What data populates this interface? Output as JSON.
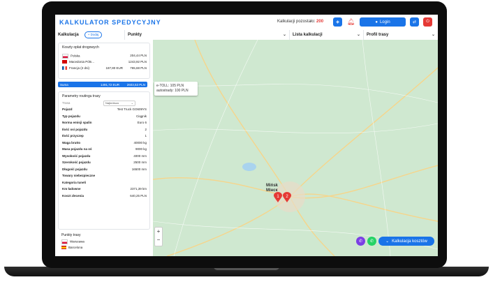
{
  "app": {
    "title": "KALKULATOR SPEDYCYJNY",
    "calc_left_label": "Kalkulacji pozostało:",
    "calc_left_value": "200",
    "login_label": "Login"
  },
  "nav": {
    "kalkulacja": "Kalkulacja",
    "dodaj": "Dodaj",
    "punkty": "Punkty",
    "lista_kalkulacji": "Lista kalkulacji",
    "profil_trasy": "Profil trasy"
  },
  "tolls": {
    "title": "Koszty opłat drogowych",
    "rows": [
      {
        "country": "Polska",
        "value": "204,44 PLN"
      },
      {
        "country": "Macedonia Półn...",
        "value": "1243,92 PLN"
      },
      {
        "country": "Francja (2 dni)",
        "value": "187,80 EUR",
        "value2": "765,68 PLN"
      }
    ],
    "sum_label": "Suma",
    "sum_eur": "1491,72 EUR",
    "sum_pln": "2603,53 PLN"
  },
  "routing": {
    "title": "Parametry routingu trasy",
    "trasa_label": "Trasa",
    "najkrotsza": "Najkrótsza",
    "params": [
      {
        "k": "Pojazd",
        "v": "Test Truck GO609YS"
      },
      {
        "k": "Typ pojazdu",
        "v": "Ciągnik"
      },
      {
        "k": "Norma emisji spalin",
        "v": "Euro 6"
      },
      {
        "k": "Ilość osi pojazdu",
        "v": "2"
      },
      {
        "k": "Ilość przyczep",
        "v": "1"
      },
      {
        "k": "Waga brutto",
        "v": "40000 kg"
      },
      {
        "k": "Masa pojazdu na oś",
        "v": "9000 kg"
      },
      {
        "k": "Wysokość pojazdu",
        "v": "4000 mm"
      },
      {
        "k": "Szerokość pojazdu",
        "v": "2500 mm"
      },
      {
        "k": "Długość pojazdu",
        "v": "16500 mm"
      },
      {
        "k": "Towary niebezpieczne",
        "v": ""
      },
      {
        "k": "Kategoria tuneli",
        "v": ""
      },
      {
        "k": "Km ładowne",
        "v": "2371,39 km"
      },
      {
        "k": "Koszt zlecenia",
        "v": "640,25 PLN"
      }
    ]
  },
  "points": {
    "title": "Punkty trasy",
    "items": [
      "Warszawa",
      "Barcelona"
    ]
  },
  "map": {
    "toll_line1": "e-TOLL: 105 PLN",
    "toll_line2": "autostrady: 100 PLN",
    "city1": "Mińsk",
    "city2": "Мінск",
    "pin1": "1",
    "pin2": "2",
    "calc_costs_label": "Kalkulacja kosztów",
    "zoom_in": "+",
    "zoom_out": "−"
  },
  "colors": {
    "accent": "#1a74e8",
    "danger": "#e53935",
    "map_bg": "#cfe8d0"
  }
}
